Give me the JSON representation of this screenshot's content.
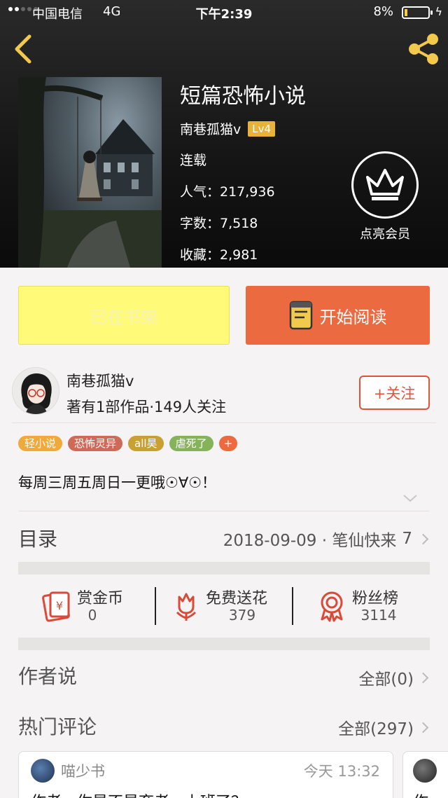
{
  "status_bar": {
    "carrier": "中国电信",
    "network": "4G",
    "time": "下午2:39",
    "battery": "8%"
  },
  "book": {
    "title": "短篇恐怖小说",
    "author": "南巷孤猫v",
    "level": "Lv4",
    "status": "连载",
    "popularity_label": "人气：217,936",
    "word_count_label": "字数：7,518",
    "favorites_label": "收藏：2,981",
    "vip_label": "点亮会员"
  },
  "actions": {
    "shelf_label": "已在书架",
    "read_label": "开始阅读"
  },
  "author_info": {
    "name": "南巷孤猫v",
    "meta": "著有1部作品·149人关注",
    "follow_label": "+关注"
  },
  "tags": [
    {
      "text": "轻小说",
      "color": "#f0a93b"
    },
    {
      "text": "恐怖灵异",
      "color": "#d06a58"
    },
    {
      "text": "all昊",
      "color": "#c9a032"
    },
    {
      "text": "虐死了",
      "color": "#84b35a"
    },
    {
      "text": "+",
      "color": "#ec6a40"
    }
  ],
  "description": "每周三周五周日一更哦☉∀☉！",
  "toc": {
    "title": "目录",
    "latest": "2018-09-09 · 笔仙快来",
    "count": "7"
  },
  "stats": [
    {
      "label": "赏金币",
      "value": "0",
      "icon": "red-envelope-icon"
    },
    {
      "label": "免费送花",
      "value": "379",
      "icon": "flower-icon"
    },
    {
      "label": "粉丝榜",
      "value": "3114",
      "icon": "medal-icon"
    }
  ],
  "author_says": {
    "title": "作者说",
    "link": "全部(0)"
  },
  "hot_comments": {
    "title": "热门评论",
    "link": "全部(297)",
    "items": [
      {
        "user": "喵少书",
        "time": "今天 13:32",
        "text": "作者，你是不是弃者，上班了？"
      },
      {
        "user": "",
        "time": "",
        "text": "作"
      }
    ]
  }
}
